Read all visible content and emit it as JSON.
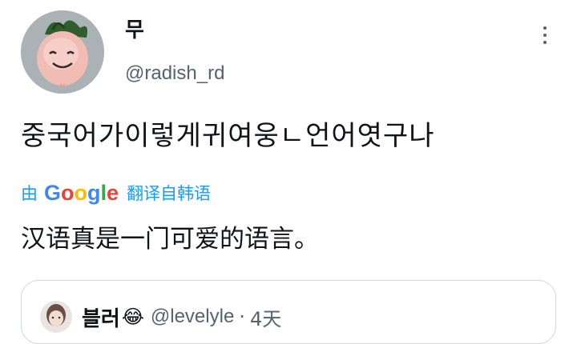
{
  "tweet": {
    "author": {
      "display_name": "무",
      "handle": "@radish_rd"
    },
    "text": "중국어가이렇게귀여웅ㄴ언어엿구나",
    "translation": {
      "by": "由",
      "provider": [
        "G",
        "o",
        "o",
        "g",
        "l",
        "e"
      ],
      "label": "翻译自韩语",
      "text": "汉语真是一门可爱的语言。"
    }
  },
  "quote": {
    "display_name": "블러",
    "emoji": "😂",
    "handle": "@levelyle",
    "separator": "·",
    "time": "4天"
  },
  "colors": {
    "link": "#1d9bf0",
    "secondary": "#536471",
    "border": "#cfd9de"
  },
  "icons": {
    "more": "more-vertical-icon"
  }
}
